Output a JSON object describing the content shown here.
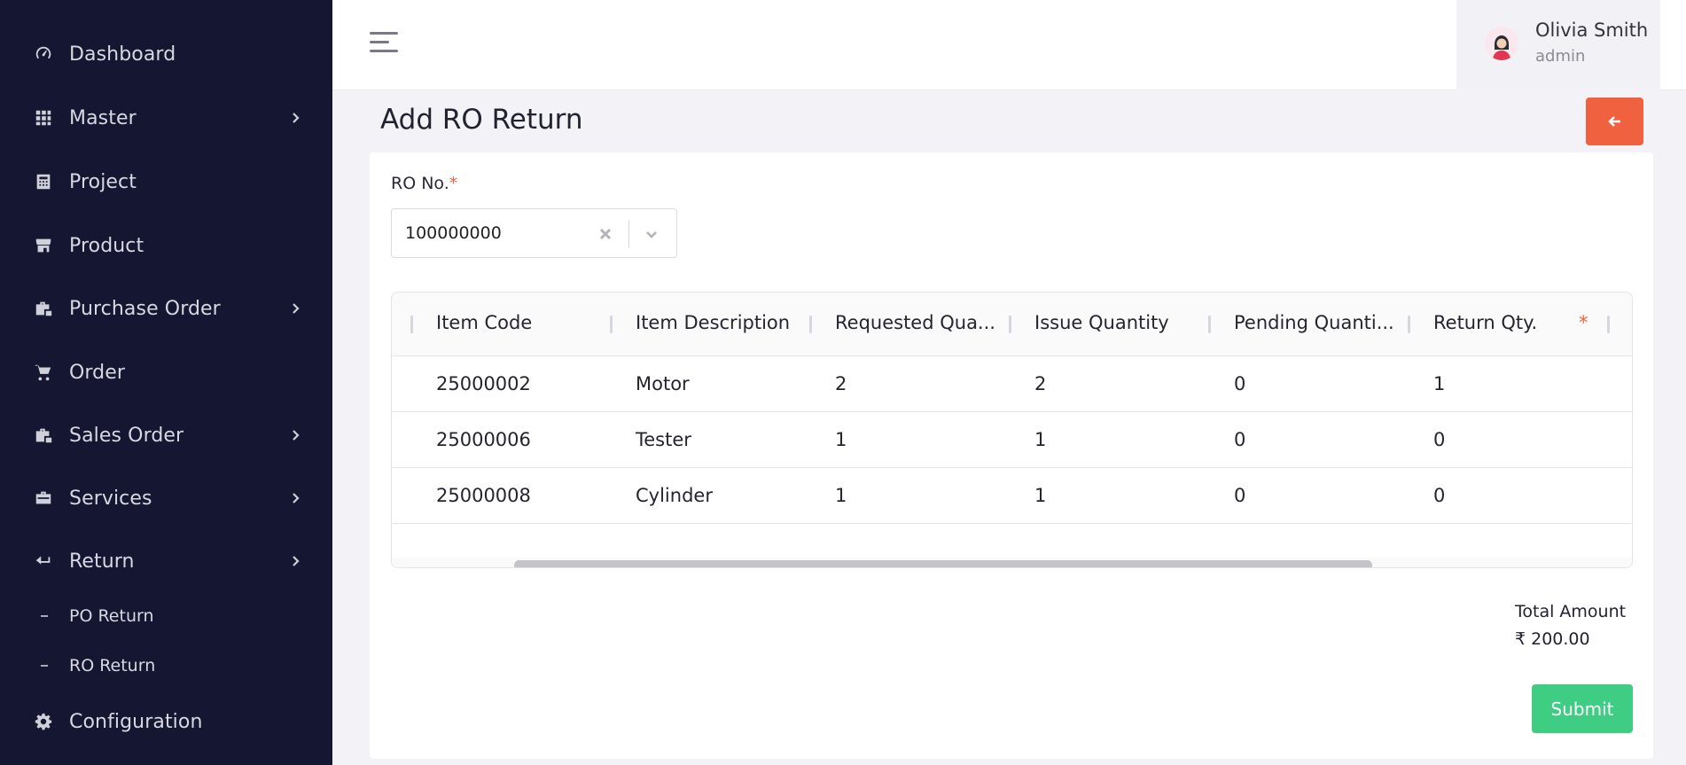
{
  "sidebar": {
    "items": [
      {
        "label": "Dashboard",
        "icon": "speedometer-icon"
      },
      {
        "label": "Master",
        "icon": "grid-icon"
      },
      {
        "label": "Project",
        "icon": "calculator-icon"
      },
      {
        "label": "Product",
        "icon": "store-icon"
      },
      {
        "label": "Purchase Order",
        "icon": "briefcase-icon"
      },
      {
        "label": "Order",
        "icon": "cart-icon"
      },
      {
        "label": "Sales Order",
        "icon": "briefcase-icon"
      },
      {
        "label": "Services",
        "icon": "toolbox-icon"
      },
      {
        "label": "Return",
        "icon": "return-arrow-icon"
      },
      {
        "label": "Configuration",
        "icon": "gear-icon"
      }
    ],
    "return_sub": [
      {
        "label": "PO Return"
      },
      {
        "label": "RO Return"
      }
    ]
  },
  "header": {
    "user_name": "Olivia Smith",
    "user_role": "admin"
  },
  "page": {
    "title": "Add RO Return"
  },
  "form": {
    "ro_label": "RO No.",
    "required_mark": "*",
    "ro_value": "100000000"
  },
  "table": {
    "columns": [
      "Item Code",
      "Item Description",
      "Requested Qua...",
      "Issue Quantity",
      "Pending Quanti...",
      "Return Qty."
    ],
    "required_mark": "*",
    "rows": [
      [
        "25000002",
        "Motor",
        "2",
        "2",
        "0",
        "1"
      ],
      [
        "25000006",
        "Tester",
        "1",
        "1",
        "0",
        "0"
      ],
      [
        "25000008",
        "Cylinder",
        "1",
        "1",
        "0",
        "0"
      ]
    ]
  },
  "summary": {
    "total_label": "Total Amount",
    "total_value": "₹ 200.00"
  },
  "actions": {
    "submit_label": "Submit"
  },
  "colors": {
    "sidebar_bg": "#151631",
    "accent_orange": "#f0613f",
    "submit_green": "#3ecd82"
  }
}
